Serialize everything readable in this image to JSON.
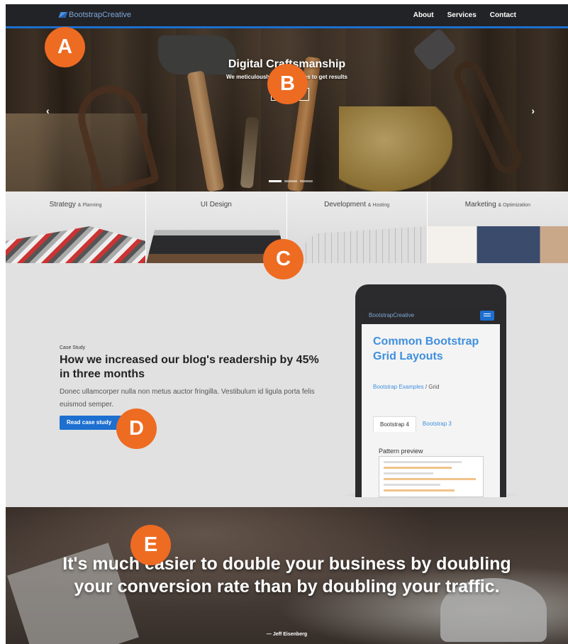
{
  "navbar": {
    "brand": "BootstrapCreative",
    "links": [
      "About",
      "Services",
      "Contact"
    ]
  },
  "hero": {
    "title": "Digital Craftsmanship",
    "subtitle": "We meticulously craft websites to get results",
    "button_label": "",
    "prev_arrow": "‹",
    "next_arrow": "›",
    "indicator_count": 3,
    "active_indicator": 0
  },
  "services": [
    {
      "title": "Strategy",
      "suffix": "& Planning"
    },
    {
      "title": "UI Design",
      "suffix": ""
    },
    {
      "title": "Development",
      "suffix": "& Hosting"
    },
    {
      "title": "Marketing",
      "suffix": "& Optimization"
    }
  ],
  "case_study": {
    "label": "Case Study",
    "title": "How we increased our blog's readership by 45% in three months",
    "text": "Donec ullamcorper nulla non metus auctor fringilla. Vestibulum id ligula porta felis euismod semper.",
    "button_label": "Read case study"
  },
  "phone": {
    "brand": "BootstrapCreative",
    "title": "Common Bootstrap Grid Layouts",
    "crumb_link": "Bootstrap Examples",
    "crumb_current": "/ Grid",
    "tabs": [
      "Bootstrap 4",
      "Bootstrap 3"
    ],
    "preview_label": "Pattern preview"
  },
  "quote": {
    "text": "It's much easier to double your business by doubling your conversion rate than by doubling your traffic.",
    "author": "— Jeff Eisenberg"
  },
  "markers": [
    "A",
    "B",
    "C",
    "D",
    "E"
  ],
  "colors": {
    "accent": "#1d6fd0",
    "marker": "#ee6b22",
    "navbar": "#222326"
  }
}
